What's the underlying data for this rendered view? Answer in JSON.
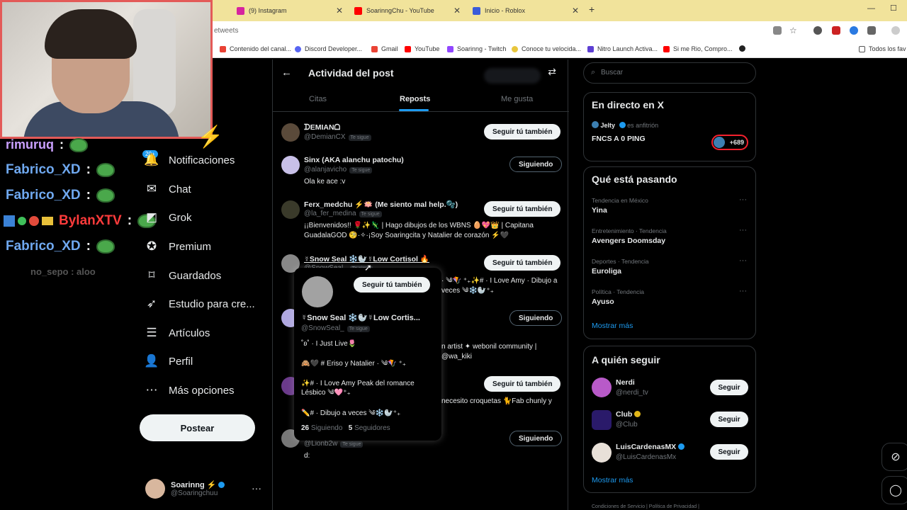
{
  "browser": {
    "tabs": [
      {
        "label": "(9) Instagram",
        "color": "#d6249f"
      },
      {
        "label": "SoarinngChu - YouTube",
        "color": "#ff0000"
      },
      {
        "label": "Inicio - Roblox",
        "color": "#3a5bd9"
      }
    ],
    "url_fragment": "etweets",
    "bookmarks": [
      {
        "label": "Contenido del canal...",
        "color": "#e94235"
      },
      {
        "label": "Discord Developer...",
        "color": "#5865f2"
      },
      {
        "label": "Gmail",
        "color": "#ea4335"
      },
      {
        "label": "YouTube",
        "color": "#ff0000"
      },
      {
        "label": "Soarinng - Twitch",
        "color": "#9146ff"
      },
      {
        "label": "Conoce tu velocida...",
        "color": "#e8c63c"
      },
      {
        "label": "Nitro Launch Activa...",
        "color": "#5d3fd3"
      },
      {
        "label": "Si me Rio, Compro...",
        "color": "#ff0000"
      }
    ],
    "bookmarks_folder": "Todos los fav"
  },
  "stream_chat": {
    "lines": [
      {
        "user": "rimuruq",
        "color": "#c9a0ff"
      },
      {
        "user": "Fabrico_XD",
        "color": "#6fa8ef"
      },
      {
        "user": "Fabrico_XD",
        "color": "#6fa8ef"
      },
      {
        "user": "BylanXTV",
        "color": "#ff3b3b"
      },
      {
        "user": "Fabrico_XD",
        "color": "#6fa8ef"
      }
    ],
    "colon": ":",
    "faded_message": "no_sepo : aloo"
  },
  "nav": {
    "badge": "20+",
    "items": [
      {
        "label": "Notificaciones",
        "icon": "bell-icon",
        "glyph": "🔔"
      },
      {
        "label": "Chat",
        "icon": "chat-icon",
        "glyph": "✉"
      },
      {
        "label": "Grok",
        "icon": "grok-icon",
        "glyph": "◩"
      },
      {
        "label": "Premium",
        "icon": "premium-icon",
        "glyph": "✪"
      },
      {
        "label": "Guardados",
        "icon": "bookmark-icon",
        "glyph": "⌑"
      },
      {
        "label": "Estudio para cre...",
        "icon": "rocket-icon",
        "glyph": "➶"
      },
      {
        "label": "Artículos",
        "icon": "articles-icon",
        "glyph": "☰"
      },
      {
        "label": "Perfil",
        "icon": "profile-icon",
        "glyph": "👤"
      },
      {
        "label": "Más opciones",
        "icon": "more-options-icon",
        "glyph": "⋯"
      }
    ],
    "post_button": "Postear",
    "profile": {
      "name": "Soarinng ⚡",
      "handle": "@Soaringchuu",
      "more": "···"
    }
  },
  "center": {
    "title": "Actividad del post",
    "tabs": [
      "Citas",
      "Reposts",
      "Me gusta"
    ],
    "active_tab": "Reposts",
    "follows_you_tag": "Te sigue",
    "rows": [
      {
        "name": "ᗪEMIANᗝ",
        "handle": "@DemianCX",
        "bio": "",
        "button": "Seguir tú también",
        "style": "light",
        "avatar": "#5a4a3a"
      },
      {
        "name": "Sinx (AKA alanchu patochu)",
        "handle": "@alanjavicho",
        "bio": "Ola ke ace :v",
        "button": "Siguiendo",
        "style": "dark",
        "avatar": "#c8c0e8"
      },
      {
        "name": "Ferx_medchu ⚡🪷 (Me siento mal help.🫧)",
        "handle": "@la_fer_medina",
        "bio": "¡¡Bienvenidos!! 🌹✨🦎 | Hago dibujos de los WBNS 🥚💖👑 | Capitana GuadalaGOD 🧐·✧·¡Soy Soaringcita y Natalier de corazón ⚡🖤",
        "button": "Seguir tú también",
        "style": "light",
        "avatar": "#3a3a2a"
      },
      {
        "name": "☿Snow Seal ❄️🦭☿Low Cortisol 🔥",
        "handle": "@SnowSeal_",
        "bio": "· ༄🪁 ⁺₊✨# · I Love Amy · Dibujo a veces ༄❄️🦭⁺₊",
        "button": "Seguir tú también",
        "style": "light",
        "avatar": "#888888"
      },
      {
        "name": "",
        "handle": "",
        "bio": "n artist ✦ webonil community | @wa_kiki",
        "button": "Siguiendo",
        "style": "dark",
        "avatar": "#b0a8e0"
      },
      {
        "name": "",
        "handle": "",
        "bio": "necesito croquetas 🐈Fab chunly y",
        "button": "Seguir tú también",
        "style": "light",
        "avatar": "#6a3a8a"
      },
      {
        "name": "",
        "handle": "@Lionb2w",
        "bio": "d:",
        "button": "Siguiendo",
        "style": "dark",
        "avatar": "#777777"
      }
    ]
  },
  "popup": {
    "button": "Seguir tú también",
    "name": "☿Snow Seal ❄️🦭☿Low Cortis...",
    "handle": "@SnowSeal_",
    "bio_lines": [
      "˚ʚ˚ · I Just Live🌷",
      "🙈🖤 # Eriso y Natalier · ༄🪁 ⁺₊",
      "✨# · I Love Amy Peak del romance Lésbico ༄🩷⁺₊",
      "✏️# · Dibujo a veces ༄❄️🦭⁺₊"
    ],
    "following_count": "26",
    "following_label": "Siguiendo",
    "followers_count": "5",
    "followers_label": "Seguidores"
  },
  "right": {
    "search_placeholder": "Buscar",
    "live": {
      "title": "En directo en X",
      "host": "Jelty",
      "host_suffix": "es anfitrión",
      "stream": "FNCS A 0 PING",
      "count": "+689"
    },
    "trends_title": "Qué está pasando",
    "trends": [
      {
        "meta": "Tendencia en México",
        "name": "Yina"
      },
      {
        "meta": "Entretenimiento · Tendencia",
        "name": "Avengers Doomsday"
      },
      {
        "meta": "Deportes · Tendencia",
        "name": "Euroliga"
      },
      {
        "meta": "Política · Tendencia",
        "name": "Ayuso"
      }
    ],
    "show_more": "Mostrar más",
    "who_title": "A quién seguir",
    "who": [
      {
        "name": "Nerdi",
        "handle": "@nerdi_tv",
        "verified": "",
        "avatar": "#b85ac8"
      },
      {
        "name": "Club",
        "handle": "@Club",
        "verified": "gold",
        "avatar": "#2a1a6a"
      },
      {
        "name": "LuisCardenasMX",
        "handle": "@LuisCardenasMx",
        "verified": "blue",
        "avatar": "#e8e0d8"
      }
    ],
    "follow_label": "Seguir",
    "footer": "Condiciones de Servicio  |  Política de Privacidad  |"
  }
}
